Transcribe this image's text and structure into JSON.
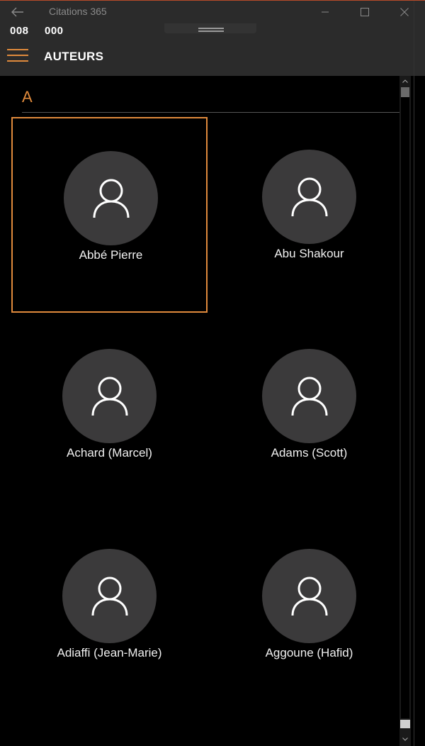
{
  "window": {
    "title": "Citations 365",
    "controls": [
      "minimize-icon",
      "maximize-icon",
      "close-icon"
    ]
  },
  "counters": {
    "left": "008",
    "right": "000"
  },
  "header": {
    "title": "AUTEURS",
    "menu_icon": "hamburger-icon"
  },
  "group": {
    "letter": "A"
  },
  "authors": [
    {
      "name": "Abbé Pierre",
      "icon": "person-icon",
      "selected": true
    },
    {
      "name": "Abu Shakour",
      "icon": "person-icon",
      "selected": false
    },
    {
      "name": "Achard (Marcel)",
      "icon": "person-icon",
      "selected": false
    },
    {
      "name": "Adams (Scott)",
      "icon": "person-icon",
      "selected": false
    },
    {
      "name": "Adiaffi (Jean-Marie)",
      "icon": "person-icon",
      "selected": false
    },
    {
      "name": "Aggoune (Hafid)",
      "icon": "person-icon",
      "selected": false
    }
  ],
  "colors": {
    "accent": "#e08a3c",
    "chrome": "#2b2b2b",
    "background": "#000000",
    "avatar": "#3b3a3b"
  }
}
